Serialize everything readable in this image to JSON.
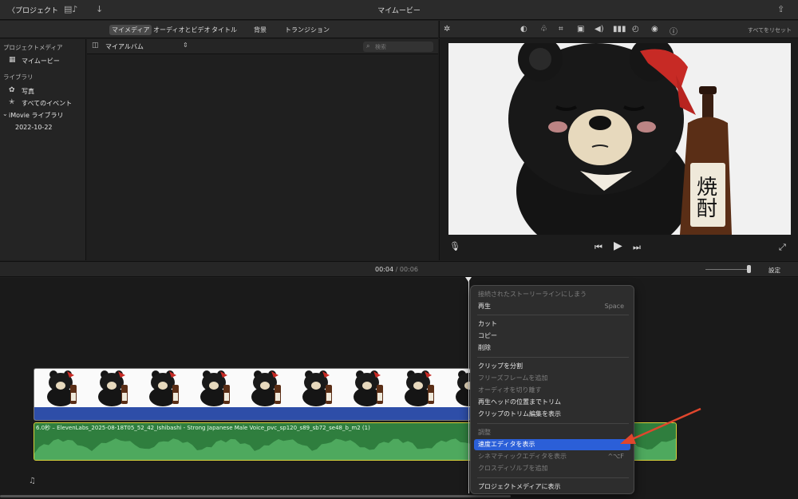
{
  "window": {
    "back_label": "〈プロジェクト",
    "title": "マイムービー"
  },
  "media_tabs": [
    {
      "label": "マイメディア",
      "active": true
    },
    {
      "label": "オーディオとビデオ",
      "active": false
    },
    {
      "label": "タイトル",
      "active": false
    },
    {
      "label": "背景",
      "active": false
    },
    {
      "label": "トランジション",
      "active": false
    }
  ],
  "sidebar": {
    "project_media_heading": "プロジェクトメディア",
    "project_item": "マイムービー",
    "library_heading": "ライブラリ",
    "photos": "写真",
    "all_events": "すべてのイベント",
    "imovie_library": "iMovie ライブラリ",
    "event_date": "2022-10-22"
  },
  "browser": {
    "album_select": "マイアルバム",
    "search_placeholder": "検索"
  },
  "viewer": {
    "reset_all": "すべてをリセット",
    "sign_text": "焼酎"
  },
  "timeline": {
    "current_time": "00:04",
    "separator": "/",
    "duration": "00:06",
    "settings_label": "設定",
    "audio_clip_label": "6.0秒 – ElevenLabs_2025-08-18T05_52_42_Ishibashi - Strong Japanese Male Voice_pvc_sp120_s89_sb72_se48_b_m2 (1)"
  },
  "context_menu": {
    "items": [
      {
        "label": "接続されたストーリーラインにしまう",
        "disabled": true,
        "shortcut": ""
      },
      {
        "label": "再生",
        "disabled": false,
        "shortcut": "Space"
      },
      {
        "label": "カット",
        "disabled": false,
        "shortcut": ""
      },
      {
        "label": "コピー",
        "disabled": false,
        "shortcut": ""
      },
      {
        "label": "削除",
        "disabled": false,
        "shortcut": ""
      },
      {
        "label": "クリップを分割",
        "disabled": false,
        "shortcut": ""
      },
      {
        "label": "フリーズフレームを追加",
        "disabled": true,
        "shortcut": ""
      },
      {
        "label": "オーディオを切り離す",
        "disabled": true,
        "shortcut": ""
      },
      {
        "label": "再生ヘッドの位置までトリム",
        "disabled": false,
        "shortcut": ""
      },
      {
        "label": "クリップのトリム編集を表示",
        "disabled": false,
        "shortcut": ""
      },
      {
        "label": "調整",
        "disabled": true,
        "shortcut": ""
      },
      {
        "label": "速度エディタを表示",
        "disabled": false,
        "shortcut": "",
        "highlight": true
      },
      {
        "label": "シネマティックエディタを表示",
        "disabled": true,
        "shortcut": "^⌥F"
      },
      {
        "label": "クロスディゾルブを追加",
        "disabled": true,
        "shortcut": ""
      },
      {
        "label": "プロジェクトメディアに表示",
        "disabled": false,
        "shortcut": ""
      }
    ]
  },
  "colors": {
    "highlight": "#2b5fd8",
    "audio_clip": "#2f7e3e",
    "selection_border": "#d8d13a",
    "annotation_arrow": "#e0462d"
  }
}
